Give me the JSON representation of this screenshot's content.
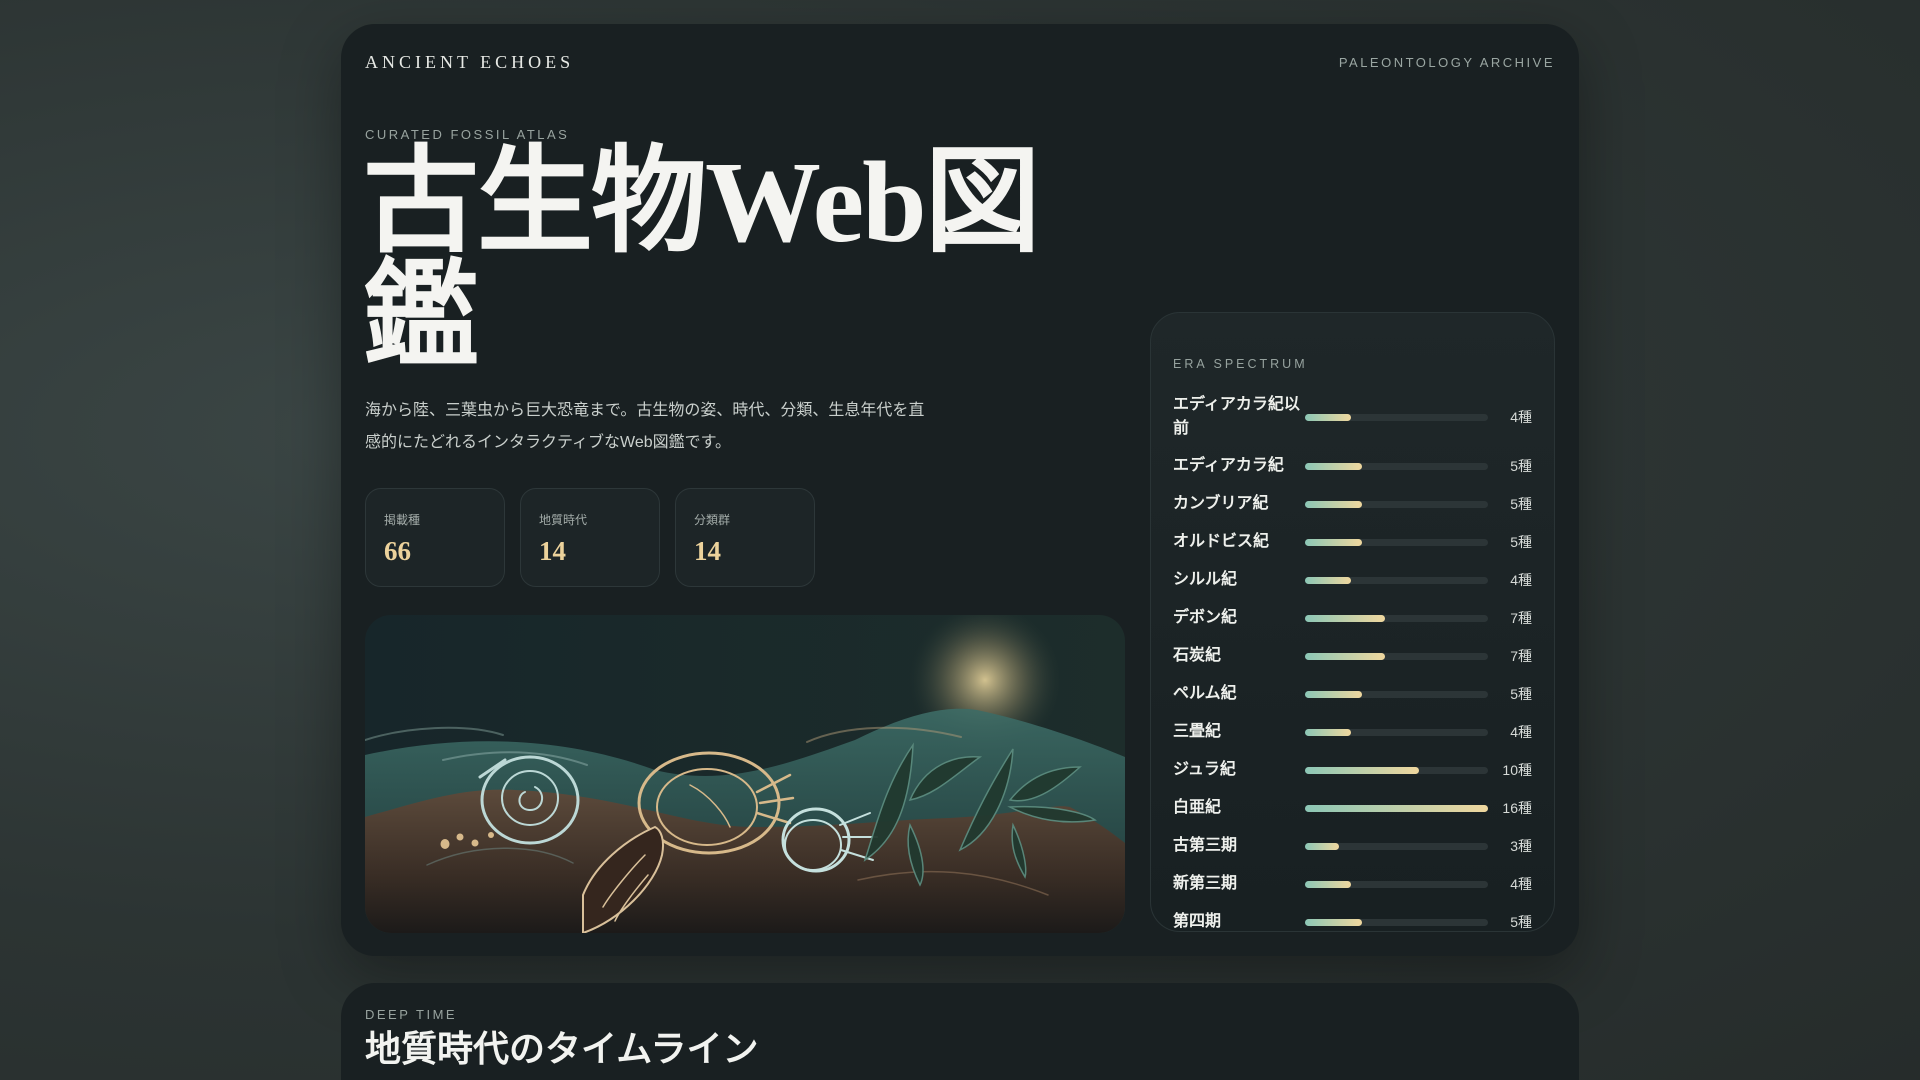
{
  "header": {
    "brand": "ANCIENT ECHOES",
    "archive": "PALEONTOLOGY ARCHIVE"
  },
  "hero": {
    "eyebrow": "CURATED FOSSIL ATLAS",
    "title_lines": [
      "古生物Web図",
      "鑑"
    ],
    "description": "海から陸、三葉虫から巨大恐竜まで。古生物の姿、時代、分類、生息年代を直感的にたどれるインタラクティブなWeb図鑑です。",
    "stats": [
      {
        "label": "掲載種",
        "value": "66"
      },
      {
        "label": "地質時代",
        "value": "14"
      },
      {
        "label": "分類群",
        "value": "14"
      }
    ]
  },
  "era_spectrum": {
    "title": "ERA SPECTRUM",
    "max": 16,
    "items": [
      {
        "name": "エディアカラ紀以前",
        "count": 4,
        "label": "4種"
      },
      {
        "name": "エディアカラ紀",
        "count": 5,
        "label": "5種"
      },
      {
        "name": "カンブリア紀",
        "count": 5,
        "label": "5種"
      },
      {
        "name": "オルドビス紀",
        "count": 5,
        "label": "5種"
      },
      {
        "name": "シルル紀",
        "count": 4,
        "label": "4種"
      },
      {
        "name": "デボン紀",
        "count": 7,
        "label": "7種"
      },
      {
        "name": "石炭紀",
        "count": 7,
        "label": "7種"
      },
      {
        "name": "ペルム紀",
        "count": 5,
        "label": "5種"
      },
      {
        "name": "三畳紀",
        "count": 4,
        "label": "4種"
      },
      {
        "name": "ジュラ紀",
        "count": 10,
        "label": "10種"
      },
      {
        "name": "白亜紀",
        "count": 16,
        "label": "16種"
      },
      {
        "name": "古第三期",
        "count": 3,
        "label": "3種"
      },
      {
        "name": "新第三期",
        "count": 4,
        "label": "4種"
      },
      {
        "name": "第四期",
        "count": 5,
        "label": "5種"
      }
    ]
  },
  "timeline": {
    "eyebrow": "DEEP TIME",
    "title": "地質時代のタイムライン"
  }
}
